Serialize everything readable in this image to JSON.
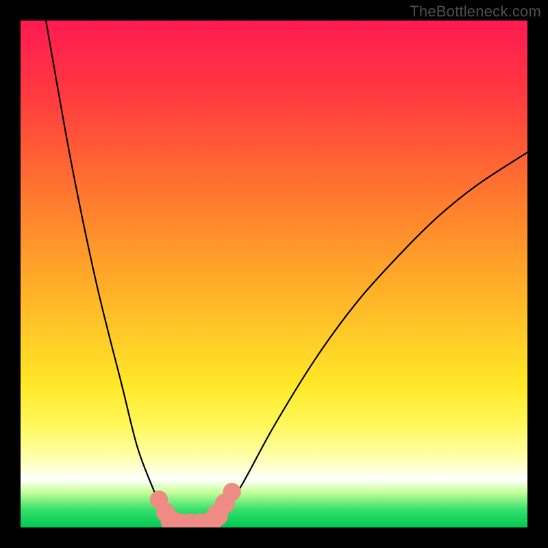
{
  "watermark": "TheBottleneck.com",
  "chart_data": {
    "type": "line",
    "title": "",
    "xlabel": "",
    "ylabel": "",
    "xlim": [
      0,
      100
    ],
    "ylim": [
      0,
      100
    ],
    "gradient_stops": [
      {
        "offset": 0.0,
        "color": "#ff1a52"
      },
      {
        "offset": 0.15,
        "color": "#ff3b3f"
      },
      {
        "offset": 0.35,
        "color": "#ff7a2e"
      },
      {
        "offset": 0.55,
        "color": "#ffb628"
      },
      {
        "offset": 0.72,
        "color": "#ffe827"
      },
      {
        "offset": 0.8,
        "color": "#fff85d"
      },
      {
        "offset": 0.86,
        "color": "#fdffa8"
      },
      {
        "offset": 0.905,
        "color": "#ffffff"
      },
      {
        "offset": 0.93,
        "color": "#c8ff9a"
      },
      {
        "offset": 0.965,
        "color": "#35e06a"
      },
      {
        "offset": 1.0,
        "color": "#00c853"
      }
    ],
    "series": [
      {
        "name": "left-branch",
        "x": [
          5.0,
          10.0,
          15.0,
          20.0,
          23.0,
          26.0,
          28.0,
          29.0,
          30.0
        ],
        "y": [
          100.0,
          72.0,
          48.0,
          28.0,
          16.0,
          8.0,
          3.5,
          1.0,
          0.0
        ]
      },
      {
        "name": "valley-floor",
        "x": [
          30.0,
          32.0,
          34.0,
          36.0,
          38.0
        ],
        "y": [
          0.0,
          0.0,
          0.0,
          0.0,
          0.0
        ]
      },
      {
        "name": "right-branch",
        "x": [
          38.0,
          40.0,
          44.0,
          50.0,
          58.0,
          66.0,
          74.0,
          82.0,
          90.0,
          100.0
        ],
        "y": [
          0.0,
          2.5,
          9.0,
          20.0,
          33.0,
          44.0,
          53.0,
          61.0,
          67.5,
          74.0
        ]
      }
    ],
    "markers": {
      "name": "pink-dots",
      "color": "#ed8b84",
      "points": [
        {
          "x": 27.3,
          "y": 5.5,
          "r": 1.1
        },
        {
          "x": 28.6,
          "y": 3.0,
          "r": 1.2
        },
        {
          "x": 29.8,
          "y": 1.2,
          "r": 1.5
        },
        {
          "x": 31.5,
          "y": 0.5,
          "r": 1.6
        },
        {
          "x": 33.5,
          "y": 0.5,
          "r": 1.6
        },
        {
          "x": 35.5,
          "y": 0.5,
          "r": 1.6
        },
        {
          "x": 37.3,
          "y": 0.7,
          "r": 1.6
        },
        {
          "x": 38.8,
          "y": 2.4,
          "r": 1.5
        },
        {
          "x": 40.3,
          "y": 4.7,
          "r": 1.3
        },
        {
          "x": 41.7,
          "y": 7.0,
          "r": 1.1
        }
      ]
    }
  }
}
